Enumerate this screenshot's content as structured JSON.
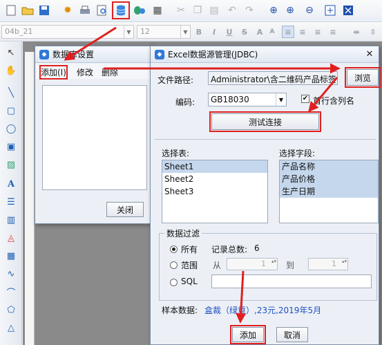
{
  "toolbar": {
    "font_name": "04b_21",
    "font_size": "12",
    "icons": [
      "new-icon",
      "open-icon",
      "save-icon",
      "settings-icon",
      "print-icon",
      "print-preview-icon",
      "database-icon",
      "data-source-icon",
      "grid-icon",
      "cut-icon",
      "copy-icon",
      "paste-icon",
      "undo-icon",
      "redo-icon",
      "zoom-fit-icon",
      "zoom-in-icon",
      "zoom-out-icon",
      "actual-size-icon",
      "fit-page-icon"
    ],
    "format_buttons": [
      "B",
      "I",
      "U",
      "S",
      "A",
      "A"
    ]
  },
  "db_dialog": {
    "title": "数据库设置",
    "menu_add": "添加(I)",
    "menu_edit": "修改",
    "menu_delete": "删除",
    "close_button": "关闭"
  },
  "excel_dialog": {
    "title": "Excel数据源管理(JDBC)",
    "file_path_label": "文件路径:",
    "file_path_value": "Administrator\\含二维码产品标签.xls",
    "browse_button": "浏览",
    "encoding_label": "编码:",
    "encoding_value": "GB18030",
    "header_checkbox_label": "首行含列名",
    "header_checked": true,
    "test_button": "测试连接",
    "select_table_label": "选择表:",
    "tables": [
      "Sheet1",
      "Sheet2",
      "Sheet3"
    ],
    "select_field_label": "选择字段:",
    "fields": [
      "产品名称",
      "产品价格",
      "生产日期"
    ],
    "filter_group_label": "数据过滤",
    "opt_all": "所有",
    "record_count_label": "记录总数:",
    "record_count": "6",
    "opt_range": "范围",
    "from_label": "从",
    "from_value": "1",
    "to_label": "到",
    "to_value": "1",
    "opt_sql": "SQL",
    "sample_label": "样本数据:",
    "sample_value": "盒裁（绿重）,23元,2019年5月",
    "add_button": "添加",
    "cancel_button": "取消"
  },
  "colors": {
    "highlight": "#e02020",
    "selection": "#c5d7ec",
    "sample_text": "#1d4fc4"
  }
}
